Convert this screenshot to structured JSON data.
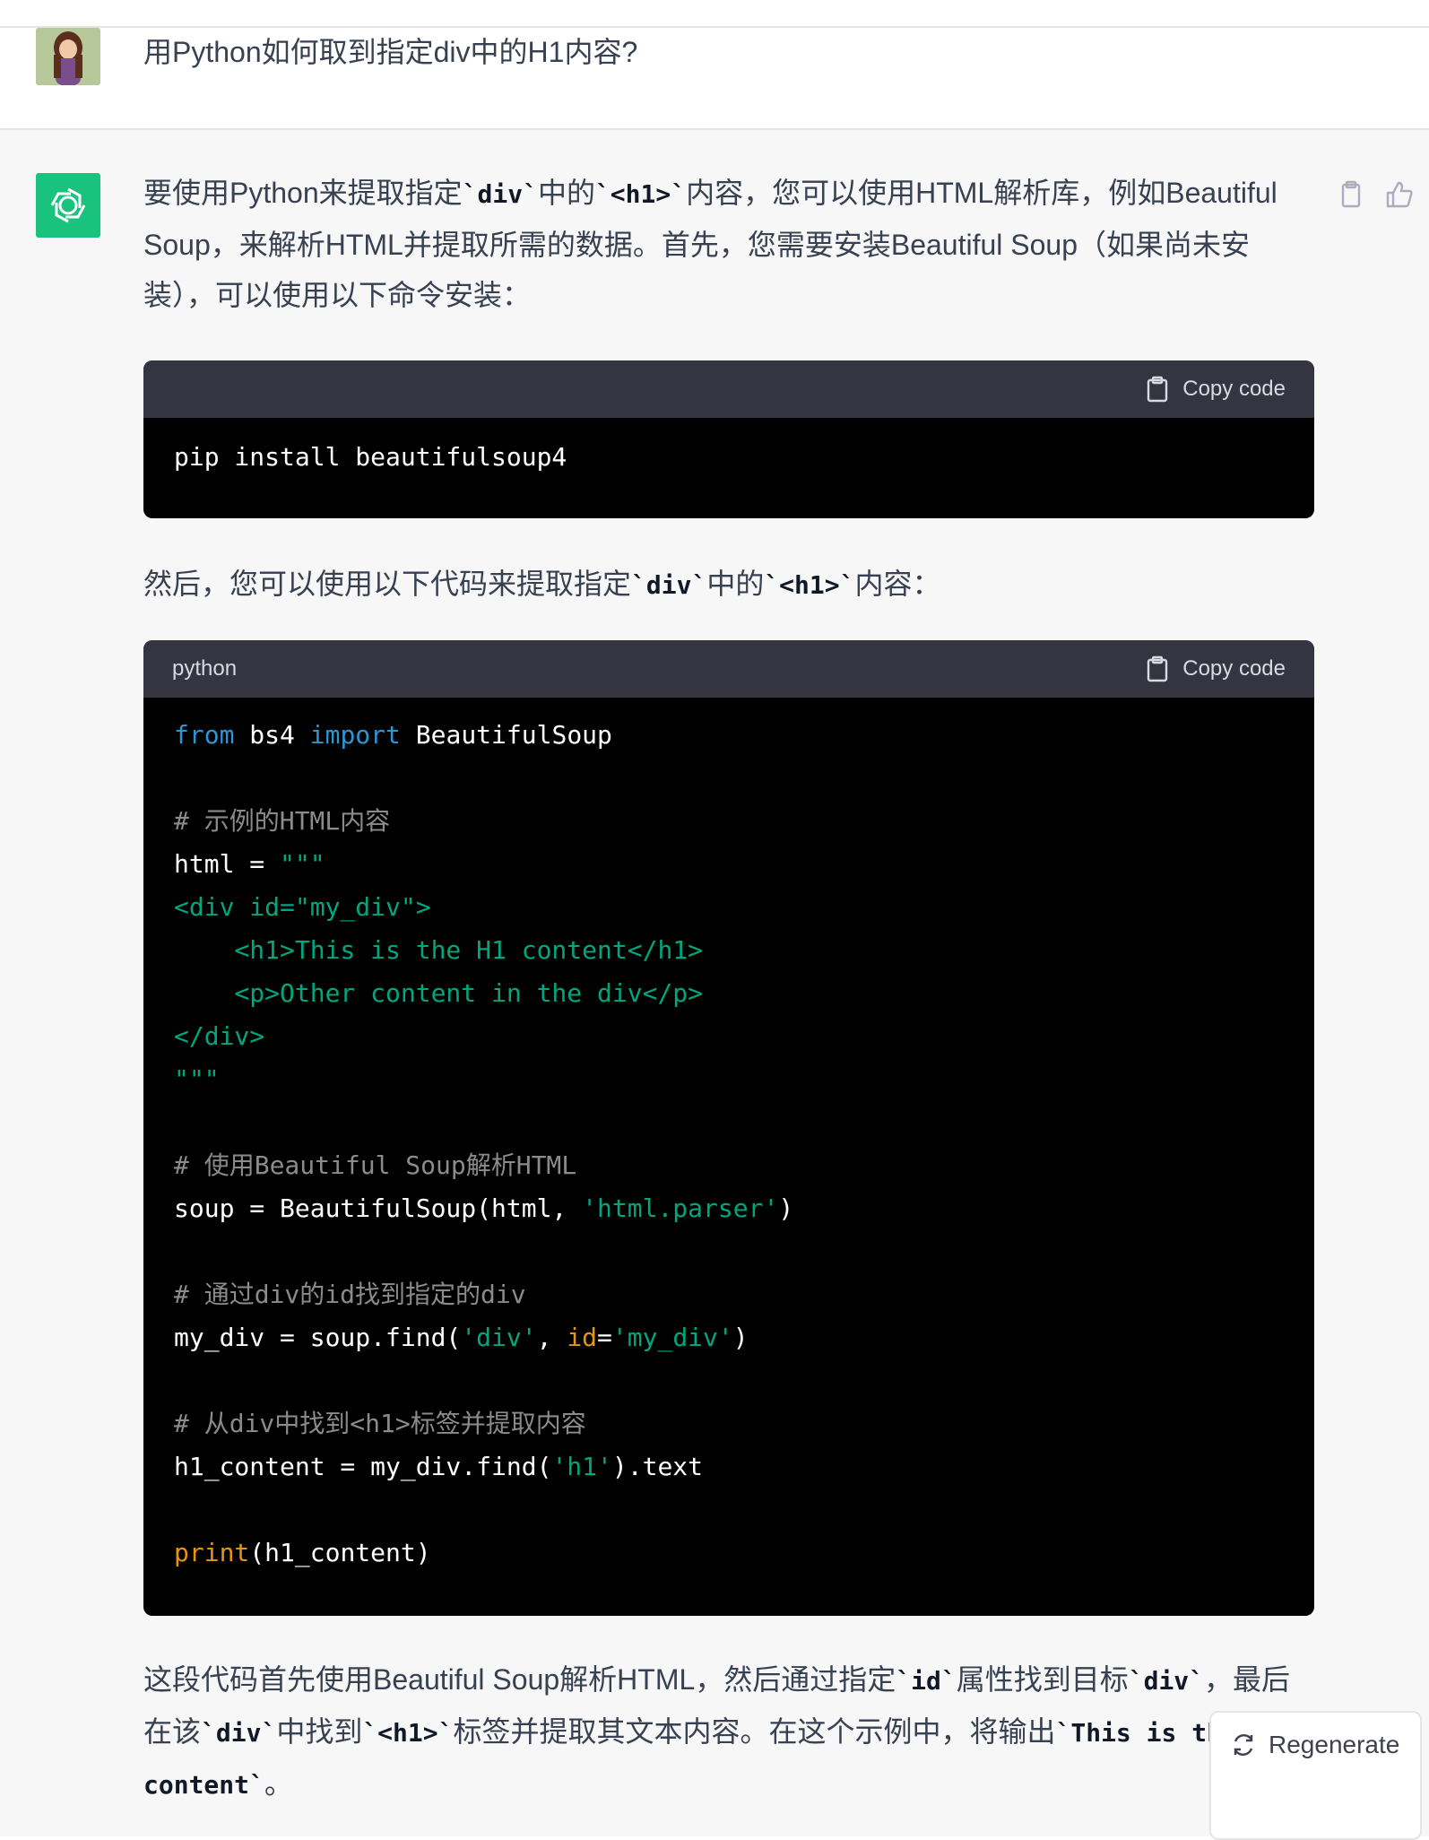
{
  "user": {
    "message": "用Python如何取到指定div中的H1内容?"
  },
  "assistant": {
    "p1": {
      "a": "要使用Python来提取指定",
      "code1": "`div`",
      "b": "中的",
      "code2": "`<h1>`",
      "c": "内容，您可以使用HTML解析库，例如Beautiful Soup，来解析HTML并提取所需的数据。首先，您需要安装Beautiful Soup（如果尚未安装），可以使用以下命令安装："
    },
    "p2": {
      "a": "然后，您可以使用以下代码来提取指定",
      "code1": "`div`",
      "b": "中的",
      "code2": "`<h1>`",
      "c": "内容："
    },
    "p3": {
      "a": "这段代码首先使用Beautiful Soup解析HTML，然后通过指定",
      "code1": "`id`",
      "b": "属性找到目标",
      "code2": "`div`",
      "c": "，最后在该",
      "code3": "`div`",
      "d": "中找到",
      "code4": "`<h1>`",
      "e": "标签并提取其文本内容。在这个示例中，将输出",
      "code5": "`This is the H1 content`",
      "f": "。"
    }
  },
  "codeblock1": {
    "lang": "",
    "copy_label": "Copy code",
    "line": "pip install beautifulsoup4"
  },
  "codeblock2": {
    "lang": "python",
    "copy_label": "Copy code",
    "l1_kw1": "from",
    "l1_mid": " bs4 ",
    "l1_kw2": "import",
    "l1_end": " BeautifulSoup",
    "c1": "# 示例的HTML内容",
    "l2a": "html = ",
    "l2b": "\"\"\"",
    "l3": "<div id=\"my_div\">",
    "l4": "    <h1>This is the H1 content</h1>",
    "l5": "    <p>Other content in the div</p>",
    "l6": "</div>",
    "l7": "\"\"\"",
    "c2": "# 使用Beautiful Soup解析HTML",
    "l8a": "soup = BeautifulSoup(html, ",
    "l8b": "'html.parser'",
    "l8c": ")",
    "c3": "# 通过div的id找到指定的div",
    "l9a": "my_div = soup.find(",
    "l9b": "'div'",
    "l9c": ", ",
    "l9d": "id",
    "l9e": "=",
    "l9f": "'my_div'",
    "l9g": ")",
    "c4": "# 从div中找到<h1>标签并提取内容",
    "l10a": "h1_content = my_div.find(",
    "l10b": "'h1'",
    "l10c": ").text",
    "l11a": "print",
    "l11b": "(h1_content)"
  },
  "regenerate_label": "Regenerate",
  "colors": {
    "accent": "#19c37d",
    "code_bg": "#000000",
    "code_header_bg": "#343541",
    "keyword": "#2e95d3",
    "string": "#00a67d",
    "function": "#e9950c",
    "comment": "#8b8b8b"
  }
}
